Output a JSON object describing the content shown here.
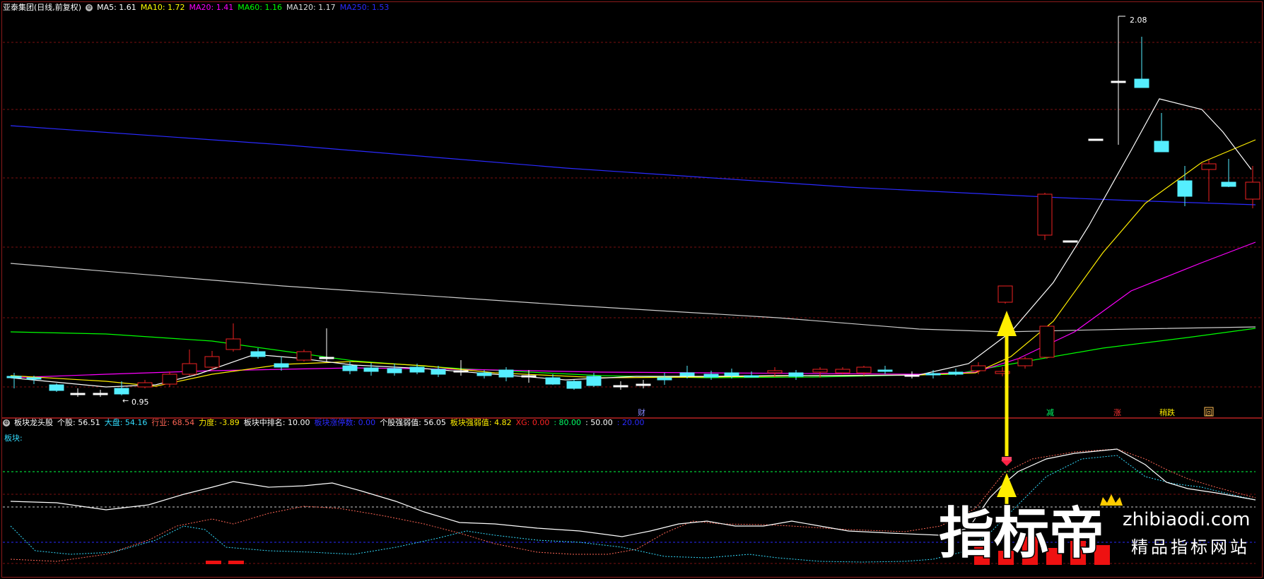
{
  "main_panel": {
    "title": "亚泰集团(日线,前复权)",
    "ma": [
      {
        "label": "MA5: 1.61",
        "color": "#ffffff"
      },
      {
        "label": "MA10: 1.72",
        "color": "#ffff00"
      },
      {
        "label": "MA20: 1.41",
        "color": "#ff00ff"
      },
      {
        "label": "MA60: 1.16",
        "color": "#00ff00"
      },
      {
        "label": "MA120: 1.17",
        "color": "#dddddd"
      },
      {
        "label": "MA250: 1.53",
        "color": "#2a2aff"
      }
    ],
    "high_label": "2.08",
    "low_label": "0.95",
    "markers": [
      {
        "text": "财",
        "color": "#8888ff"
      },
      {
        "text": "减",
        "color": "#00ff66"
      },
      {
        "text": "涨",
        "color": "#ff3333"
      },
      {
        "text": "稍跌",
        "color": "#ffee00"
      },
      {
        "text": "回",
        "color": "#ffbb55"
      }
    ]
  },
  "sub_panel": {
    "title": "板块龙头股",
    "indicators": [
      {
        "label": "个股: 56.51",
        "color": "#ffffff"
      },
      {
        "label": "大盘: 54.16",
        "color": "#33ddff"
      },
      {
        "label": "行业: 68.54",
        "color": "#ff6655"
      },
      {
        "label": "力度: -3.89",
        "color": "#ffee00"
      },
      {
        "label": "板块中排名: 10.00",
        "color": "#ffffff"
      },
      {
        "label": "板块涨停数: 0.00",
        "color": "#2a2aff"
      },
      {
        "label": "个股强弱值: 56.05",
        "color": "#ffffff"
      },
      {
        "label": "板块强弱值: 4.82",
        "color": "#ffee00"
      },
      {
        "label": "XG: 0.00",
        "color": "#ff2222"
      },
      {
        "label": ": 80.00",
        "color": "#00ff66"
      },
      {
        "label": ": 50.00",
        "color": "#ffffff"
      },
      {
        "label": ": 20.00",
        "color": "#2a2aff"
      }
    ],
    "sector_label": "板块:"
  },
  "watermark": {
    "brand": "指标帝",
    "domain": "zhibiaodi.com",
    "tagline": "精品指标网站"
  }
}
